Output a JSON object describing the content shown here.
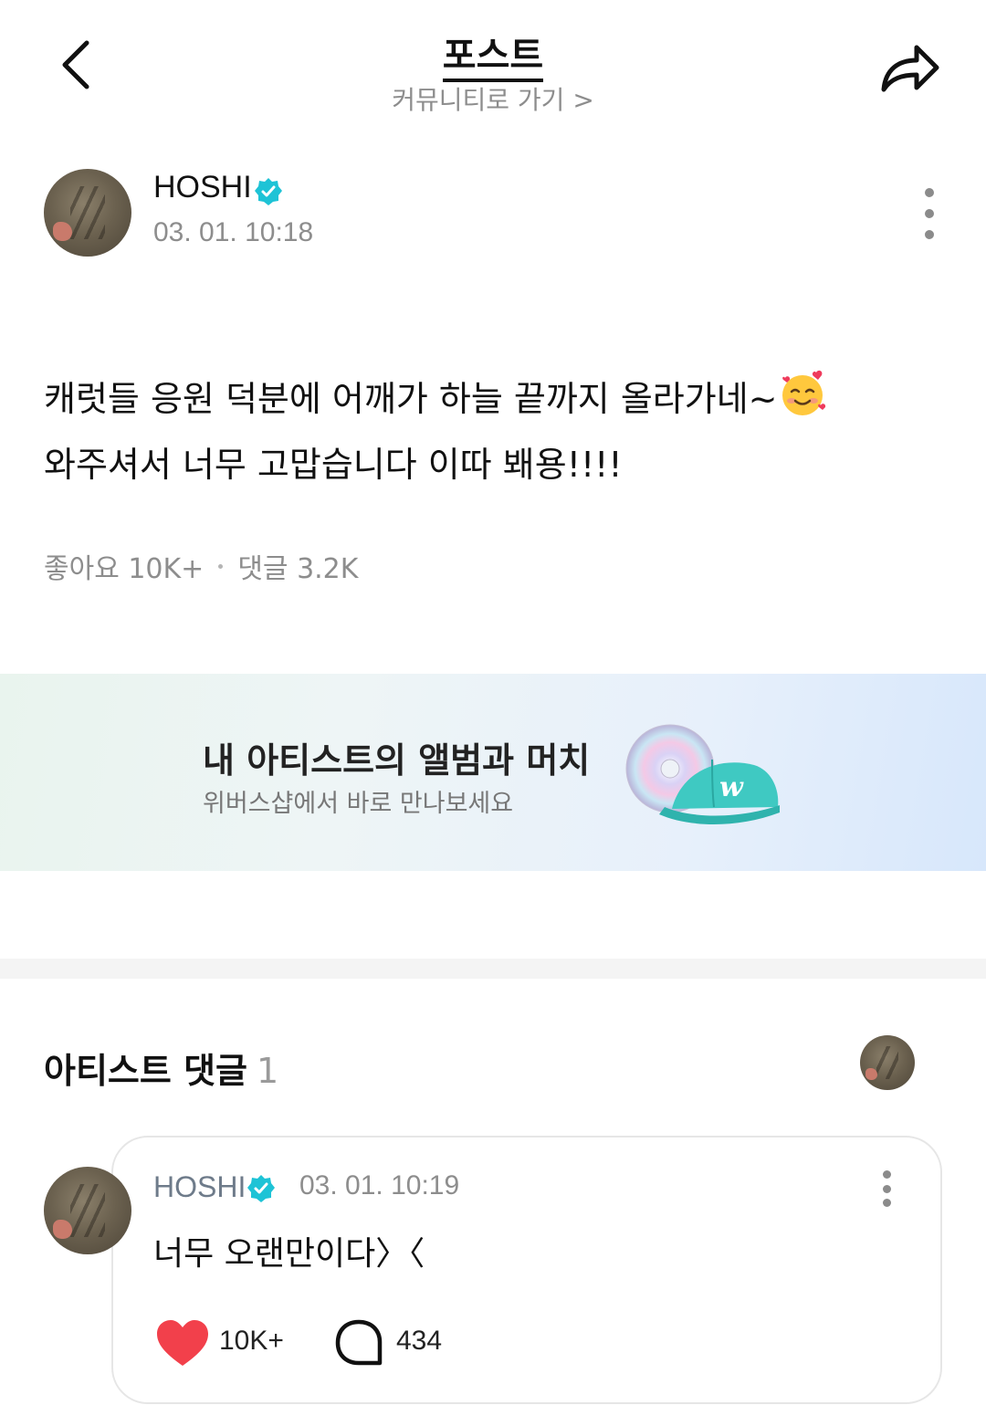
{
  "header": {
    "title": "포스트",
    "community_link": "커뮤니티로 가기 >",
    "back_icon": "chevron-left-icon",
    "share_icon": "share-arrow-icon"
  },
  "post": {
    "author": "HOSHI",
    "time": "03. 01. 10:18",
    "body_line1": "캐럿들 응원 덕분에 어깨가 하늘 끝까지 올라가네~",
    "body_line2": "와주셔서 너무 고맙습니다 이따 봬용!!!!",
    "emoji": "smiling-face-with-hearts-emoji",
    "likes_label": "좋아요 10K+",
    "comments_label": "댓글 3.2K"
  },
  "banner": {
    "title": "내 아티스트의 앨범과 머치",
    "subtitle": "위버스샵에서 바로 만나보세요"
  },
  "artist_comments": {
    "title": "아티스트 댓글",
    "count": "1",
    "comment": {
      "author": "HOSHI",
      "time": "03. 01. 10:19",
      "text": "너무 오랜만이다〉〈",
      "likes": "10K+",
      "replies": "434"
    }
  },
  "colors": {
    "verified": "#1ec3d6",
    "heart": "#f2404b",
    "muted": "#8d8d8d"
  }
}
